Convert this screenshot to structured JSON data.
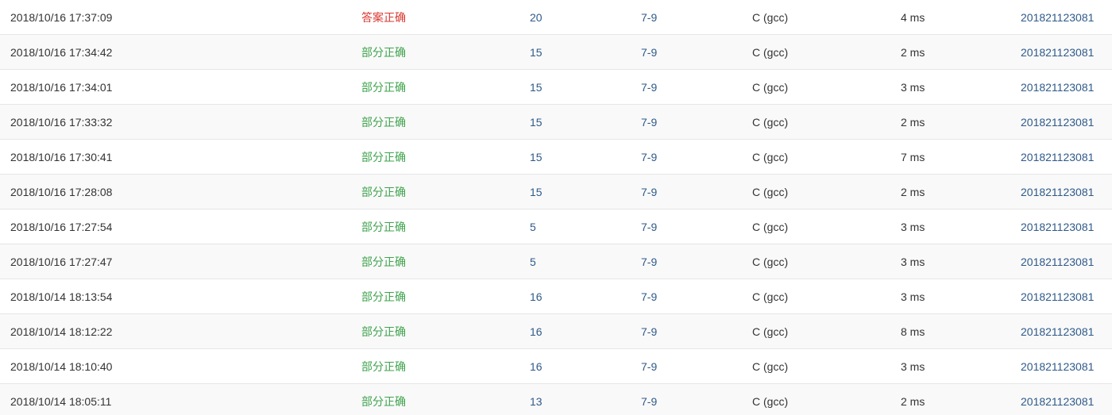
{
  "colors": {
    "accepted": "#d9372f",
    "partial": "#3fa34d",
    "link": "#2f5a8a",
    "row_border": "#e6e6e6",
    "alt_row_bg": "#f9f9f9"
  },
  "submissions": [
    {
      "time": "2018/10/16 17:37:09",
      "status": "答案正确",
      "status_type": "accepted",
      "score": "20",
      "problem": "7-9",
      "compiler": "C (gcc)",
      "runtime": "4 ms",
      "user": "201821123081"
    },
    {
      "time": "2018/10/16 17:34:42",
      "status": "部分正确",
      "status_type": "partial",
      "score": "15",
      "problem": "7-9",
      "compiler": "C (gcc)",
      "runtime": "2 ms",
      "user": "201821123081"
    },
    {
      "time": "2018/10/16 17:34:01",
      "status": "部分正确",
      "status_type": "partial",
      "score": "15",
      "problem": "7-9",
      "compiler": "C (gcc)",
      "runtime": "3 ms",
      "user": "201821123081"
    },
    {
      "time": "2018/10/16 17:33:32",
      "status": "部分正确",
      "status_type": "partial",
      "score": "15",
      "problem": "7-9",
      "compiler": "C (gcc)",
      "runtime": "2 ms",
      "user": "201821123081"
    },
    {
      "time": "2018/10/16 17:30:41",
      "status": "部分正确",
      "status_type": "partial",
      "score": "15",
      "problem": "7-9",
      "compiler": "C (gcc)",
      "runtime": "7 ms",
      "user": "201821123081"
    },
    {
      "time": "2018/10/16 17:28:08",
      "status": "部分正确",
      "status_type": "partial",
      "score": "15",
      "problem": "7-9",
      "compiler": "C (gcc)",
      "runtime": "2 ms",
      "user": "201821123081"
    },
    {
      "time": "2018/10/16 17:27:54",
      "status": "部分正确",
      "status_type": "partial",
      "score": "5",
      "problem": "7-9",
      "compiler": "C (gcc)",
      "runtime": "3 ms",
      "user": "201821123081"
    },
    {
      "time": "2018/10/16 17:27:47",
      "status": "部分正确",
      "status_type": "partial",
      "score": "5",
      "problem": "7-9",
      "compiler": "C (gcc)",
      "runtime": "3 ms",
      "user": "201821123081"
    },
    {
      "time": "2018/10/14 18:13:54",
      "status": "部分正确",
      "status_type": "partial",
      "score": "16",
      "problem": "7-9",
      "compiler": "C (gcc)",
      "runtime": "3 ms",
      "user": "201821123081"
    },
    {
      "time": "2018/10/14 18:12:22",
      "status": "部分正确",
      "status_type": "partial",
      "score": "16",
      "problem": "7-9",
      "compiler": "C (gcc)",
      "runtime": "8 ms",
      "user": "201821123081"
    },
    {
      "time": "2018/10/14 18:10:40",
      "status": "部分正确",
      "status_type": "partial",
      "score": "16",
      "problem": "7-9",
      "compiler": "C (gcc)",
      "runtime": "3 ms",
      "user": "201821123081"
    },
    {
      "time": "2018/10/14 18:05:11",
      "status": "部分正确",
      "status_type": "partial",
      "score": "13",
      "problem": "7-9",
      "compiler": "C (gcc)",
      "runtime": "2 ms",
      "user": "201821123081"
    }
  ]
}
